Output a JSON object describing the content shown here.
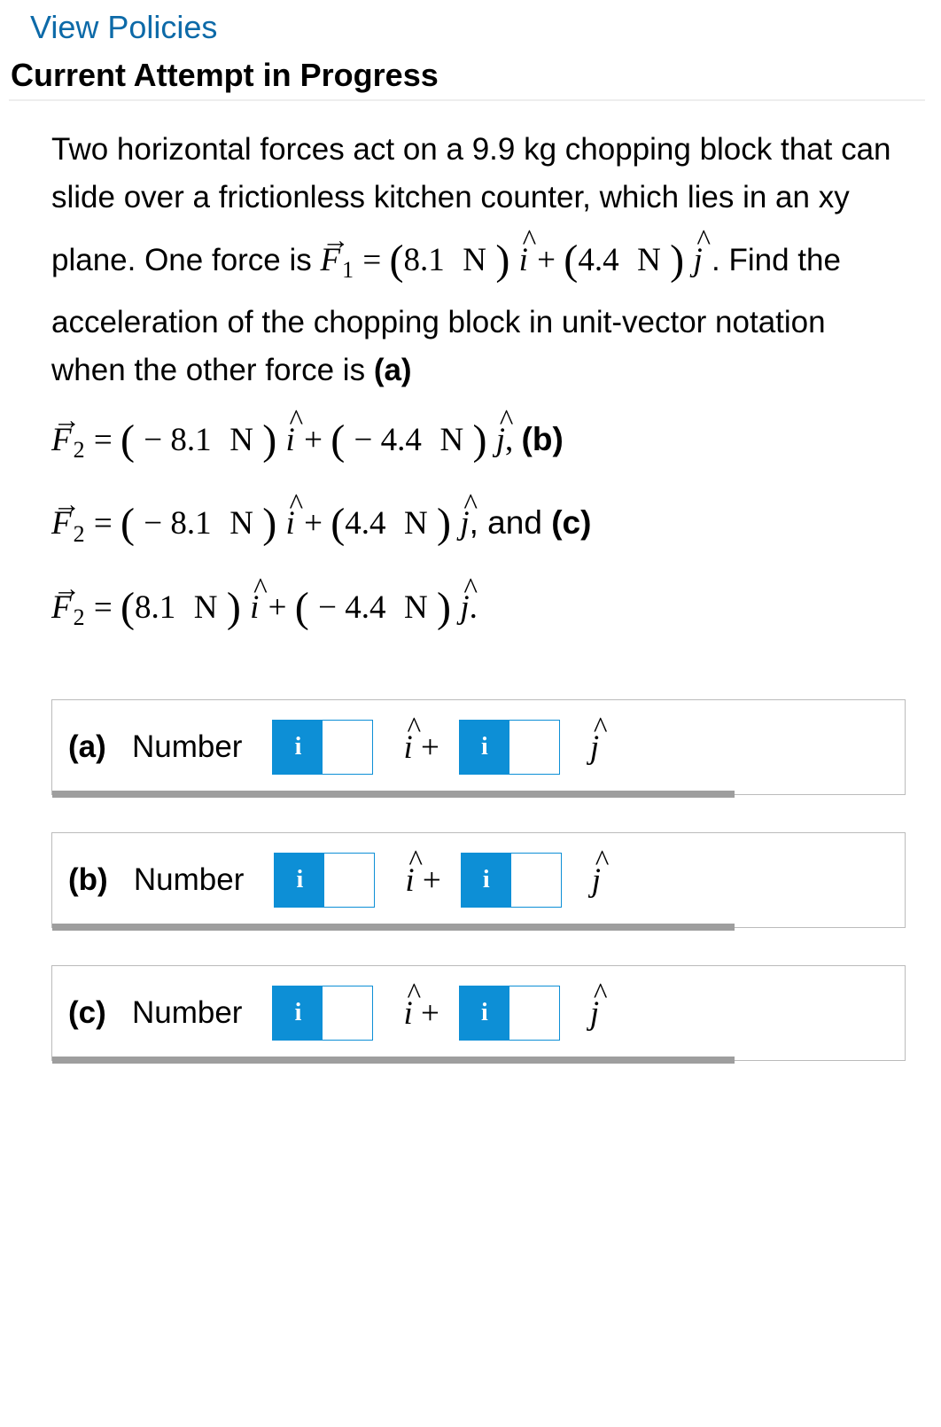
{
  "header": {
    "view_policies": "View Policies",
    "current_attempt": "Current Attempt in Progress"
  },
  "problem": {
    "intro_1": "Two horizontal forces act on a ",
    "mass": "9.9 kg",
    "intro_2": " chopping block that can slide over a frictionless kitchen counter, which lies in an xy plane. One force is ",
    "F1_i": "8.1",
    "F1_j": "4.4",
    "unit": "N",
    "intro_3": ". Find the acceleration of the chopping block in unit-vector notation when the other force is ",
    "part_a_label": "(a)",
    "F2a_i": "− 8.1",
    "F2a_j": "− 4.4",
    "part_b_label": "(b)",
    "F2b_i": "− 8.1",
    "F2b_j": "4.4",
    "and_text": ", and ",
    "part_c_label": "(c)",
    "F2c_i": "8.1",
    "F2c_j": "− 4.4"
  },
  "answers": {
    "a": {
      "label": "(a)",
      "word": "Number"
    },
    "b": {
      "label": "(b)",
      "word": "Number"
    },
    "c": {
      "label": "(c)",
      "word": "Number"
    }
  },
  "info_icon": "i"
}
